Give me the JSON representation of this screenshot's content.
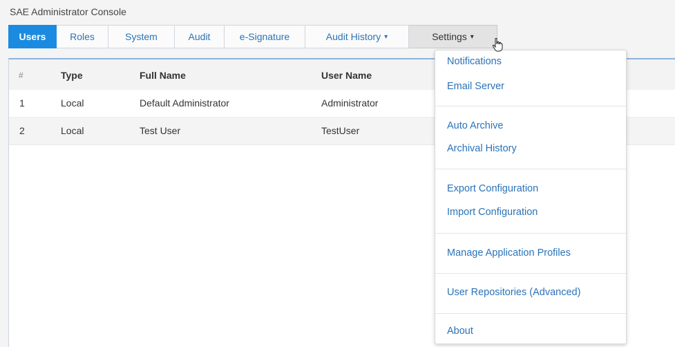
{
  "app": {
    "title": "SAE Administrator Console"
  },
  "tabs": [
    {
      "label": "Users"
    },
    {
      "label": "Roles"
    },
    {
      "label": "System"
    },
    {
      "label": "Audit"
    },
    {
      "label": "e-Signature"
    },
    {
      "label": "Audit History",
      "caret": "▾"
    },
    {
      "label": "Settings",
      "caret": "▾"
    }
  ],
  "table": {
    "headers": {
      "num": "#",
      "type": "Type",
      "full_name": "Full Name",
      "user_name": "User Name"
    },
    "rows": [
      {
        "num": "1",
        "type": "Local",
        "full_name": "Default Administrator",
        "user_name": "Administrator"
      },
      {
        "num": "2",
        "type": "Local",
        "full_name": "Test User",
        "user_name": "TestUser"
      }
    ]
  },
  "settings_menu": {
    "items": [
      {
        "label": "Notifications"
      },
      {
        "label": "Email Server"
      },
      {
        "label": "Auto Archive"
      },
      {
        "label": "Archival History"
      },
      {
        "label": "Export Configuration"
      },
      {
        "label": "Import Configuration"
      },
      {
        "label": "Manage Application Profiles"
      },
      {
        "label": "User Repositories (Advanced)"
      },
      {
        "label": "About"
      }
    ]
  },
  "colors": {
    "accent": "#1a8be0",
    "link": "#2a73b8"
  }
}
